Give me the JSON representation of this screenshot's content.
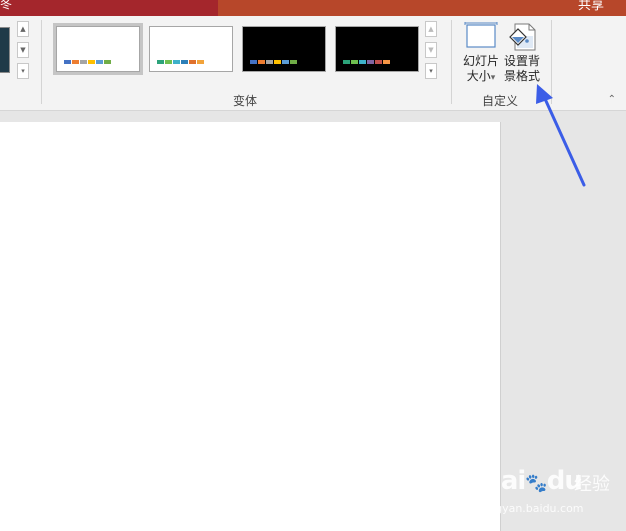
{
  "titlebar": {
    "left_glyph": "冬",
    "share_label": "共享"
  },
  "variants": {
    "group_label": "变体",
    "items": [
      {
        "background": "#ffffff",
        "colors": [
          "#4472c4",
          "#ed7d31",
          "#a5a5a5",
          "#ffc000",
          "#5b9bd5",
          "#70ad47"
        ]
      },
      {
        "background": "#ffffff",
        "colors": [
          "#2ca37a",
          "#6fbf4f",
          "#3db1c9",
          "#2c7fb8",
          "#e0712c",
          "#f2a33a"
        ]
      },
      {
        "background": "#000000",
        "colors": [
          "#4472c4",
          "#ed7d31",
          "#a5a5a5",
          "#ffc000",
          "#5b9bd5",
          "#70ad47"
        ]
      },
      {
        "background": "#000000",
        "colors": [
          "#2ca37a",
          "#6fbf4f",
          "#3db1c9",
          "#8064a2",
          "#c0504d",
          "#f79646"
        ]
      }
    ]
  },
  "customize": {
    "group_label": "自定义",
    "slide_size_line1": "幻灯片",
    "slide_size_line2": "大小",
    "slide_size_dropdown": "▾",
    "format_bg_line1": "设置背",
    "format_bg_line2": "景格式"
  },
  "watermark": {
    "brand": "Bai",
    "brand2": "du",
    "sub": "经验",
    "url": "jingyan.baidu.com"
  },
  "colors": {
    "title_dark": "#a4262c",
    "title_main": "#b7472a",
    "arrow": "#3b5de7"
  }
}
